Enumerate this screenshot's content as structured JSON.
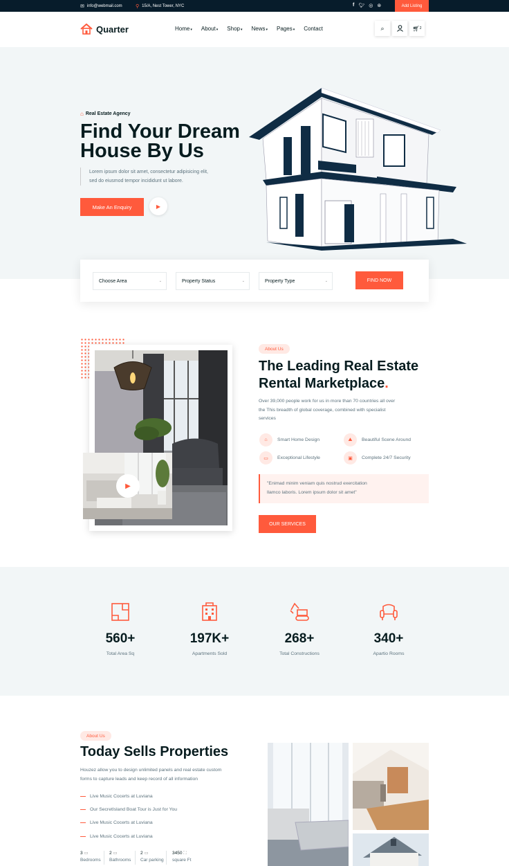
{
  "topbar": {
    "email": "info@webmail.com",
    "address": "15/A, Nest Tower, NYC",
    "social": [
      "facebook-icon",
      "twitter-icon",
      "instagram-icon",
      "dribbble-icon"
    ],
    "add_listing": "Add Listing"
  },
  "header": {
    "brand": "Quarter",
    "nav": [
      {
        "label": "Home",
        "dropdown": true
      },
      {
        "label": "About",
        "dropdown": true
      },
      {
        "label": "Shop",
        "dropdown": true
      },
      {
        "label": "News",
        "dropdown": true
      },
      {
        "label": "Pages",
        "dropdown": true
      },
      {
        "label": "Contact",
        "dropdown": false
      }
    ],
    "cart_count": "2"
  },
  "hero": {
    "tag": "Real Estate Agency",
    "title_line1": "Find Your Dream",
    "title_line2": "House By Us",
    "desc_line1": "Lorem ipsum dolor sit amet, consectetur adipisicing elit,",
    "desc_line2": "sed do eiusmod tempor incididunt ut labore.",
    "cta": "Make An Enquiry"
  },
  "search": {
    "area": "Choose Area",
    "status": "Property Status",
    "type": "Property Type",
    "button": "FIND NOW"
  },
  "about": {
    "pill": "About Us",
    "title_line1": "The Leading Real Estate",
    "title_line2": "Rental Marketplace",
    "title_dot": ".",
    "desc_line1": "Over 39,000 people work for us in more than 70 countries all over",
    "desc_line2": "the This breadth of global coverage, combined with specialist",
    "desc_line3": "services",
    "features": [
      "Smart Home Design",
      "Beautiful Scene Around",
      "Exceptional Lifestyle",
      "Complete 24/7 Security"
    ],
    "quote_line1": "\"Enimad minim veniam quis nostrud exercitation",
    "quote_line2": "llamco laboris. Lorem ipsum dolor sit amet\"",
    "button": "OUR SERVICES"
  },
  "stats": [
    {
      "num": "560+",
      "label": "Total Area Sq"
    },
    {
      "num": "197K+",
      "label": "Apartments Sold"
    },
    {
      "num": "268+",
      "label": "Total Constructions"
    },
    {
      "num": "340+",
      "label": "Apartio Rooms"
    }
  ],
  "sells": {
    "pill": "About Us",
    "title": "Today Sells Properties",
    "desc_line1": "Houzez allow you to design unlimited panels and real estate custom",
    "desc_line2": "forms to capture leads and keep record of all information",
    "list": [
      "Live Music Cocerts at Luviana",
      "Our SecretIsland Boat Tour is Just for You",
      "Live Music Cocerts at Luviana",
      "Live Music Cocerts at Luviana"
    ],
    "facts": [
      {
        "value": "3",
        "label": "Bedrooms"
      },
      {
        "value": "2",
        "label": "Bathrooms"
      },
      {
        "value": "2",
        "label": "Car parking"
      },
      {
        "value": "3450",
        "label": "square Ft"
      }
    ]
  },
  "colors": {
    "accent": "#ff5a3c",
    "dark": "#071c2b",
    "light_bg": "#f2f6f7"
  }
}
